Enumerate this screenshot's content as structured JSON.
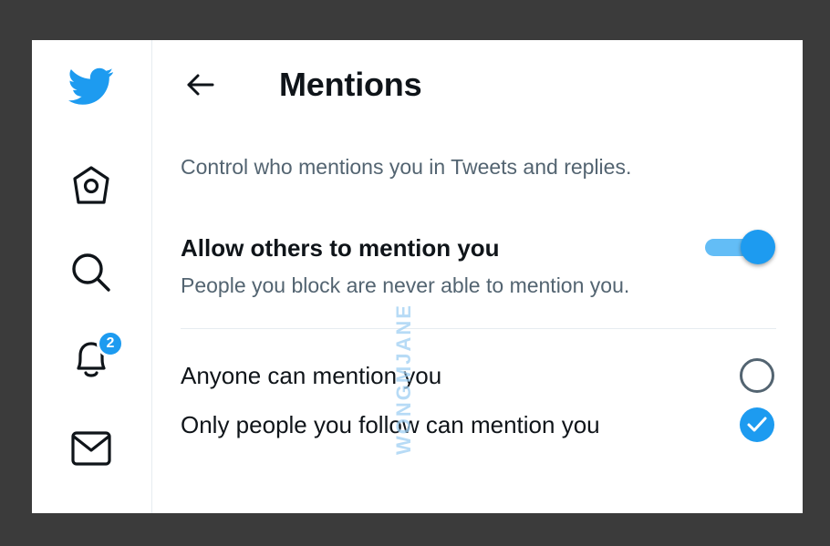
{
  "sidebar": {
    "items": [
      {
        "icon": "twitter-bird-icon"
      },
      {
        "icon": "home-icon"
      },
      {
        "icon": "search-icon"
      },
      {
        "icon": "bell-icon",
        "badge": "2"
      },
      {
        "icon": "mail-icon"
      }
    ]
  },
  "header": {
    "back_icon": "arrow-left-icon",
    "title": "Mentions"
  },
  "content": {
    "description": "Control who mentions you in Tweets and replies.",
    "allow_setting": {
      "label": "Allow others to mention you",
      "sublabel": "People you block are never able to mention you.",
      "enabled": true
    },
    "options": [
      {
        "label": "Anyone can mention you",
        "selected": false
      },
      {
        "label": "Only people you follow can mention you",
        "selected": true
      }
    ]
  },
  "watermark": "WONGMJANE",
  "colors": {
    "accent": "#1d9bf0",
    "toggle_track": "#63bdf6",
    "text_primary": "#0f1419",
    "text_secondary": "#536471",
    "background": "#3b3b3b"
  }
}
